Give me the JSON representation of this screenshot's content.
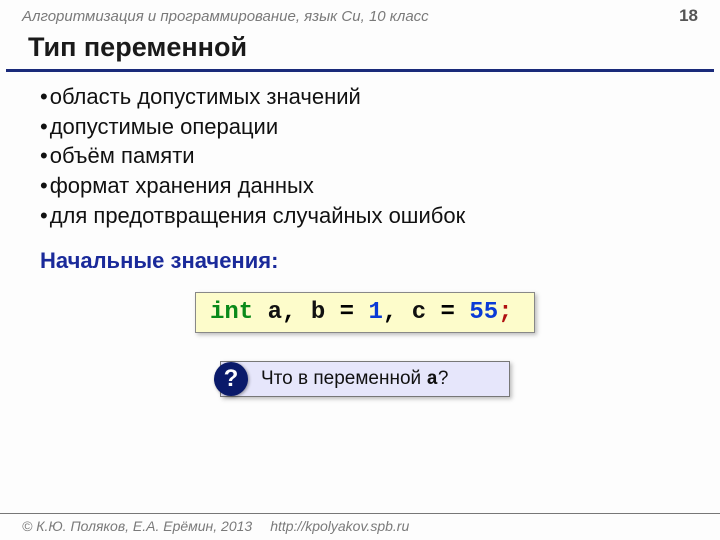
{
  "header": {
    "course": "Алгоритмизация и программирование, язык Си, 10 класс",
    "page": "18"
  },
  "title": "Тип переменной",
  "bullets": [
    "область допустимых значений",
    "допустимые операции",
    "объём памяти",
    "формат хранения данных",
    "для предотвращения случайных ошибок"
  ],
  "subhead": "Начальные значения:",
  "code": {
    "type": "int",
    "sp1": " ",
    "v1": "a",
    "c1": ", ",
    "v2": "b",
    "eq1": " = ",
    "n1": "1",
    "c2": ", ",
    "v3": "c",
    "eq2": " = ",
    "n2": "55",
    "semi": ";"
  },
  "question": {
    "badge": "?",
    "prefix": "Что в переменной ",
    "var": "a",
    "suffix": "?"
  },
  "footer": {
    "copyright": "© К.Ю. Поляков, Е.А. Ерёмин, 2013",
    "url": "http://kpolyakov.spb.ru"
  }
}
